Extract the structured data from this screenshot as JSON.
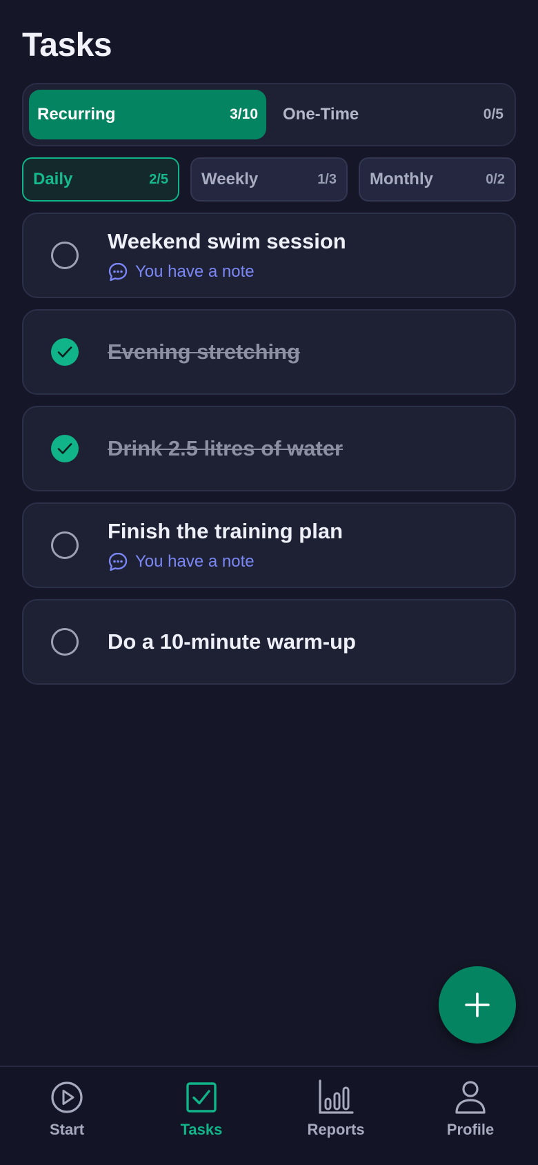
{
  "page": {
    "title": "Tasks"
  },
  "segments": [
    {
      "label": "Recurring",
      "count": "3/10",
      "active": true
    },
    {
      "label": "One-Time",
      "count": "0/5",
      "active": false
    }
  ],
  "frequencies": [
    {
      "label": "Daily",
      "count": "2/5",
      "active": true
    },
    {
      "label": "Weekly",
      "count": "1/3",
      "active": false
    },
    {
      "label": "Monthly",
      "count": "0/2",
      "active": false
    }
  ],
  "tasks": [
    {
      "title": "Weekend swim session",
      "done": false,
      "note": "You have a note"
    },
    {
      "title": "Evening stretching",
      "done": true,
      "note": null
    },
    {
      "title": "Drink 2.5 litres of water",
      "done": true,
      "note": null
    },
    {
      "title": "Finish the training plan",
      "done": false,
      "note": "You have a note"
    },
    {
      "title": "Do a 10-minute warm-up",
      "done": false,
      "note": null
    }
  ],
  "fab": {
    "icon": "plus-icon"
  },
  "nav": [
    {
      "label": "Start",
      "icon": "play-circle-icon",
      "active": false
    },
    {
      "label": "Tasks",
      "icon": "checkbox-icon",
      "active": true
    },
    {
      "label": "Reports",
      "icon": "bar-chart-icon",
      "active": false
    },
    {
      "label": "Profile",
      "icon": "person-icon",
      "active": false
    }
  ],
  "colors": {
    "background": "#151728",
    "accent": "#10b488",
    "accent_dark": "#058462",
    "note": "#7a87f5",
    "card": "#1e2034"
  }
}
